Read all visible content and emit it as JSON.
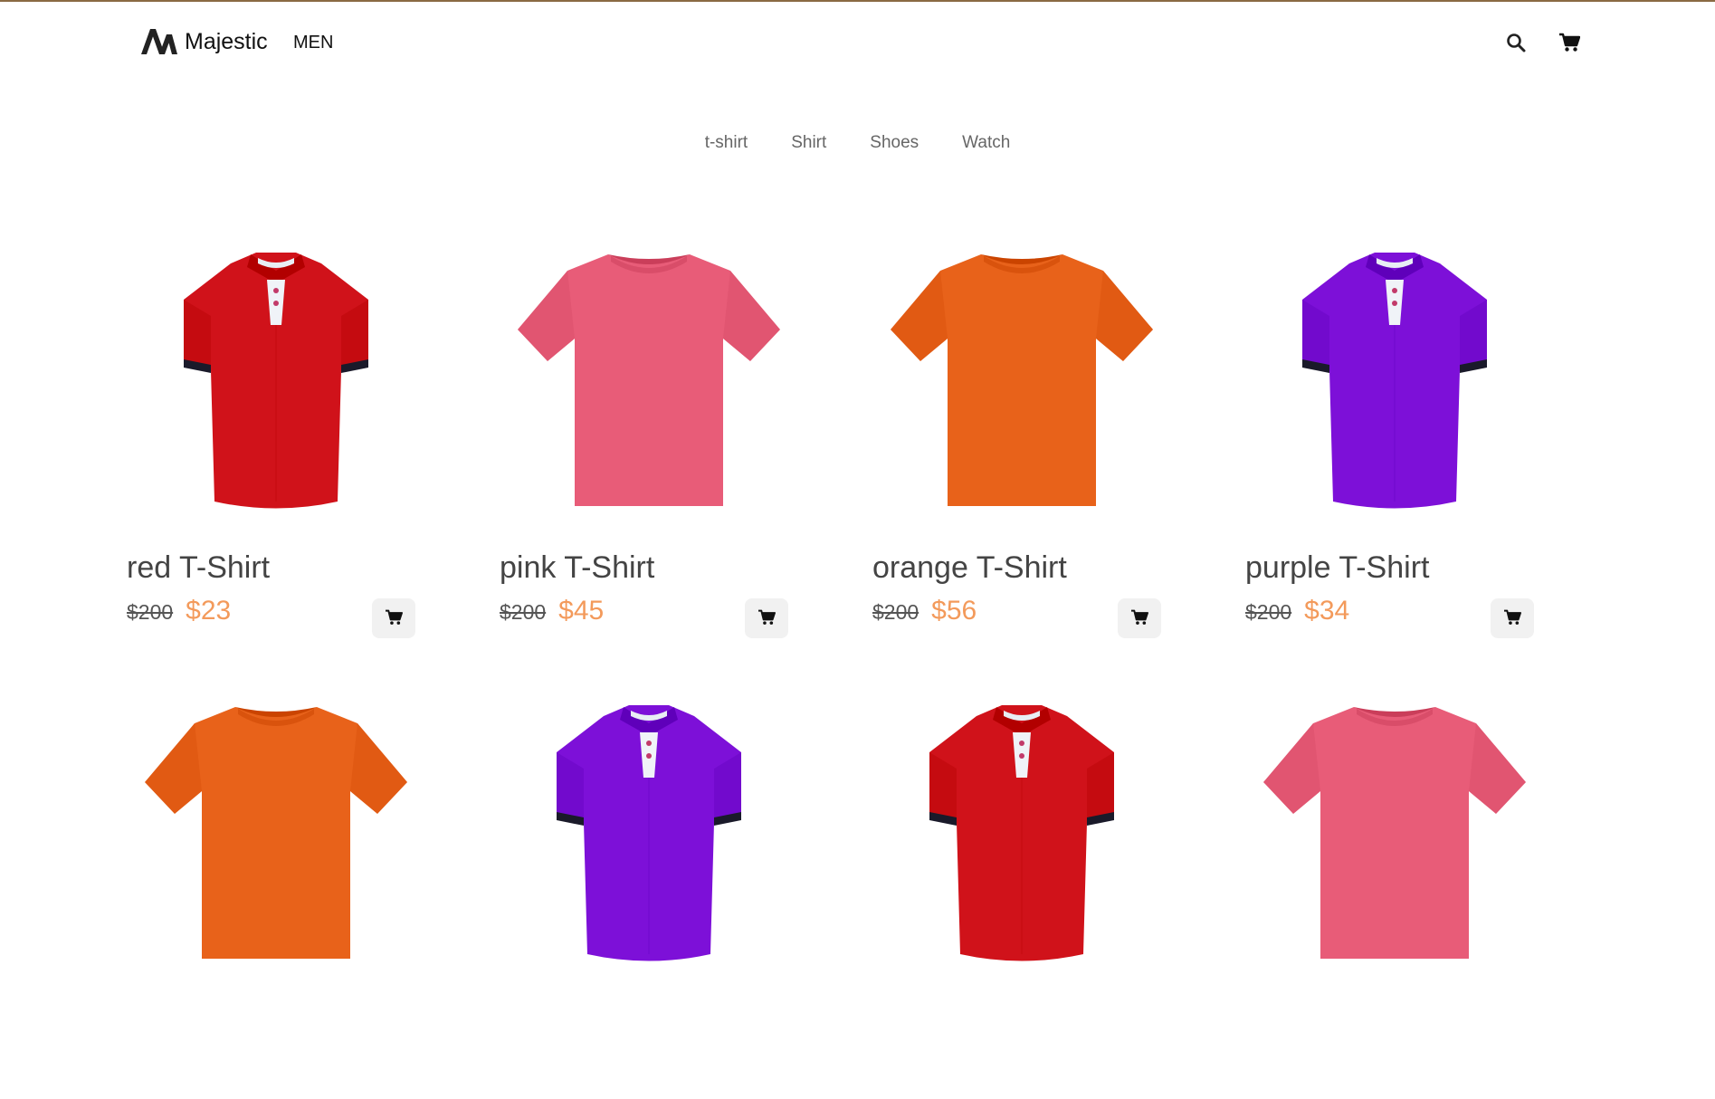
{
  "header": {
    "brand": "Majestic",
    "nav_label": "MEN",
    "search_icon": "search-icon",
    "cart_icon": "cart-icon"
  },
  "tabs": [
    "t-shirt",
    "Shirt",
    "Shoes",
    "Watch"
  ],
  "colors": {
    "accent_price": "#f39a5b",
    "tab_text": "#666666",
    "cart_button_bg": "#f1f1f1"
  },
  "products": [
    {
      "title": "red T-Shirt",
      "old_price": "$200",
      "new_price": "$23",
      "shirt_color": "#d0121a",
      "style": "polo"
    },
    {
      "title": "pink T-Shirt",
      "old_price": "$200",
      "new_price": "$45",
      "shirt_color": "#e85c78",
      "style": "tee"
    },
    {
      "title": "orange T-Shirt",
      "old_price": "$200",
      "new_price": "$56",
      "shirt_color": "#e8621a",
      "style": "tee"
    },
    {
      "title": "purple T-Shirt",
      "old_price": "$200",
      "new_price": "$34",
      "shirt_color": "#7d10d8",
      "style": "polo"
    },
    {
      "title": "",
      "old_price": "",
      "new_price": "",
      "shirt_color": "#e8621a",
      "style": "tee"
    },
    {
      "title": "",
      "old_price": "",
      "new_price": "",
      "shirt_color": "#7d10d8",
      "style": "polo"
    },
    {
      "title": "",
      "old_price": "",
      "new_price": "",
      "shirt_color": "#d0121a",
      "style": "polo"
    },
    {
      "title": "",
      "old_price": "",
      "new_price": "",
      "shirt_color": "#e85c78",
      "style": "tee"
    }
  ]
}
